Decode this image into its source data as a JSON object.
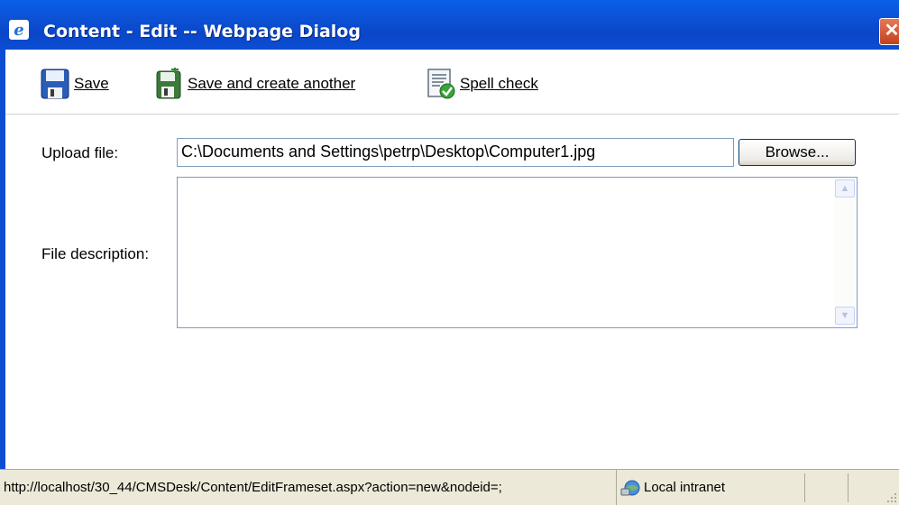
{
  "window": {
    "title": "Content - Edit -- Webpage Dialog",
    "close_symbol": "✕"
  },
  "toolbar": {
    "items": [
      {
        "label": "Save",
        "icon": "floppy-disk-icon"
      },
      {
        "label": "Save and create another",
        "icon": "save-add-icon"
      },
      {
        "label": "Spell check",
        "icon": "spell-check-icon"
      }
    ]
  },
  "form": {
    "upload_label": "Upload file:",
    "upload_value": "C:\\Documents and Settings\\petrp\\Desktop\\Computer1.jpg",
    "browse_label": "Browse...",
    "description_label": "File description:",
    "description_value": ""
  },
  "statusbar": {
    "url": "http://localhost/30_44/CMSDesk/Content/EditFrameset.aspx?action=new&nodeid=;",
    "zone": "Local intranet"
  },
  "colors": {
    "titlebar": "#0b4ed4",
    "statusbar": "#ece9d8",
    "input_border": "#7f9db9"
  }
}
